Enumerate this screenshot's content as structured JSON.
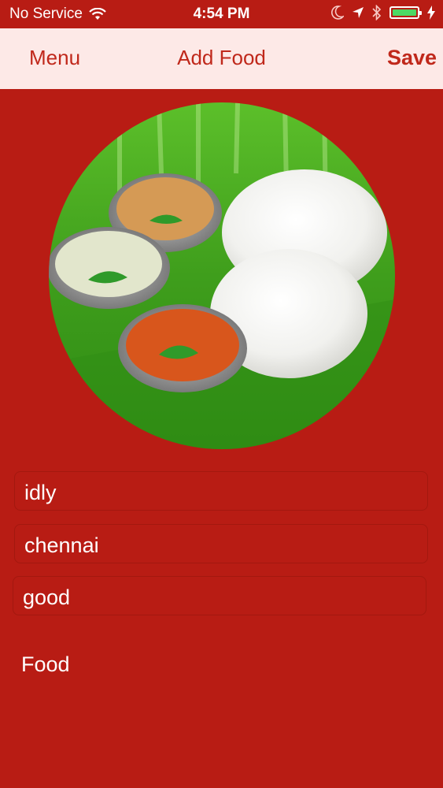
{
  "status_bar": {
    "carrier": "No Service",
    "time": "4:54 PM",
    "battery_color": "#4cd964"
  },
  "nav": {
    "left_label": "Menu",
    "title": "Add Food",
    "right_label": "Save"
  },
  "photo": {
    "icon": "food-photo-idly-sambar"
  },
  "form": {
    "name_value": "idly",
    "location_value": "chennai",
    "review_value": "good",
    "category_label": "Food"
  },
  "colors": {
    "background": "#b81c14",
    "nav_background": "#fde9e7",
    "accent": "#c0281b"
  }
}
